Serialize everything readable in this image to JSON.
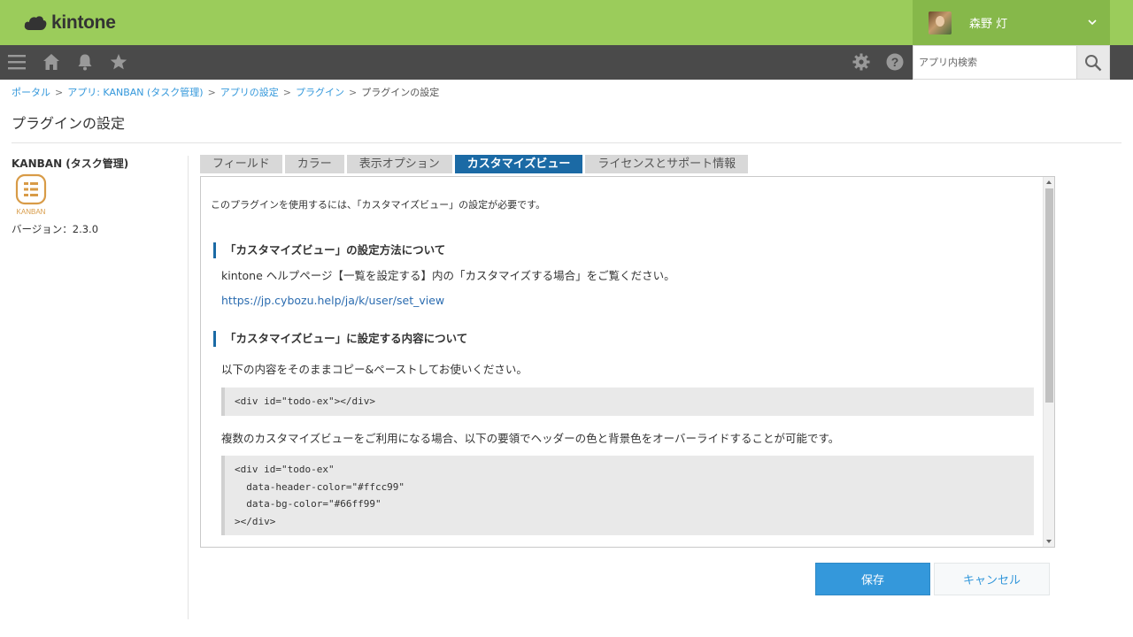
{
  "header": {
    "logo_text": "kintone",
    "user_name": "森野 灯"
  },
  "toolbar": {
    "search_placeholder": "アプリ内検索"
  },
  "breadcrumb": [
    {
      "label": "ポータル"
    },
    {
      "label": "アプリ: KANBAN (タスク管理)"
    },
    {
      "label": "アプリの設定"
    },
    {
      "label": "プラグイン"
    },
    {
      "label": "プラグインの設定"
    }
  ],
  "page": {
    "title": "プラグインの設定"
  },
  "plugin": {
    "name": "KANBAN (タスク管理)",
    "icon_label": "KANBAN",
    "version": "バージョン：2.3.0"
  },
  "tabs": [
    {
      "label": "フィールド",
      "active": false
    },
    {
      "label": "カラー",
      "active": false
    },
    {
      "label": "表示オプション",
      "active": false
    },
    {
      "label": "カスタマイズビュー",
      "active": true
    },
    {
      "label": "ライセンスとサポート情報",
      "active": false
    }
  ],
  "content": {
    "intro": "このプラグインを使用するには、「カスタマイズビュー」の設定が必要です。",
    "section1": {
      "heading": "「カスタマイズビュー」の設定方法について",
      "text": "kintone ヘルプページ【一覧を設定する】内の「カスタマイズする場合」をご覧ください。",
      "link": "https://jp.cybozu.help/ja/k/user/set_view"
    },
    "section2": {
      "heading": "「カスタマイズビュー」に設定する内容について",
      "text": "以下の内容をそのままコピー&ペーストしてお使いください。",
      "code1": "<div id=\"todo-ex\"></div>",
      "text2": "複数のカスタマイズビューをご利用になる場合、以下の要領でヘッダーの色と背景色をオーバーライドすることが可能です。",
      "code2": "<div id=\"todo-ex\"\n  data-header-color=\"#ffcc99\"\n  data-bg-color=\"#66ff99\"\n></div>"
    }
  },
  "buttons": {
    "save": "保存",
    "cancel": "キャンセル"
  },
  "colors": {
    "header_green": "#9bcc5b",
    "toolbar_dark": "#4a4a4a",
    "active_tab": "#1b6aa5",
    "save_button": "#3498db",
    "link": "#3498db"
  },
  "icons": {
    "menu": "hamburger-menu-icon",
    "home": "home-icon",
    "notifications": "bell-icon",
    "favorites": "star-icon",
    "settings": "gear-icon",
    "help": "question-icon",
    "search": "search-icon",
    "user_menu": "chevron-down-icon"
  }
}
